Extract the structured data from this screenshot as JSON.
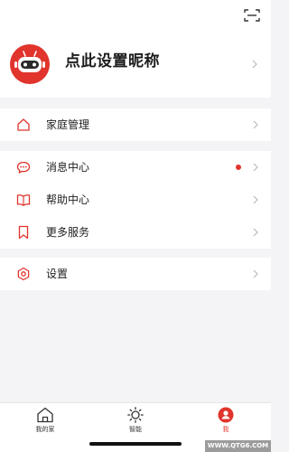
{
  "profile": {
    "nickname": "点此设置昵称"
  },
  "menu_groups": [
    {
      "items": [
        {
          "label": "家庭管理",
          "icon": "house-icon"
        }
      ]
    },
    {
      "items": [
        {
          "label": "消息中心",
          "icon": "chat-bubble-icon",
          "badge": "unread-dot"
        },
        {
          "label": "帮助中心",
          "icon": "book-icon"
        },
        {
          "label": "更多服务",
          "icon": "bookmark-icon"
        }
      ]
    },
    {
      "items": [
        {
          "label": "设置",
          "icon": "hexagon-gear-icon"
        }
      ]
    }
  ],
  "tabs": [
    {
      "label": "我的家",
      "icon": "home-icon"
    },
    {
      "label": "智能",
      "icon": "sun-icon"
    },
    {
      "label": "我",
      "icon": "user-icon",
      "active": true
    }
  ],
  "watermark": "WWW.QTG6.COM",
  "colors": {
    "accent": "#e0342c",
    "background": "#f4f4f6",
    "surface": "#ffffff"
  }
}
